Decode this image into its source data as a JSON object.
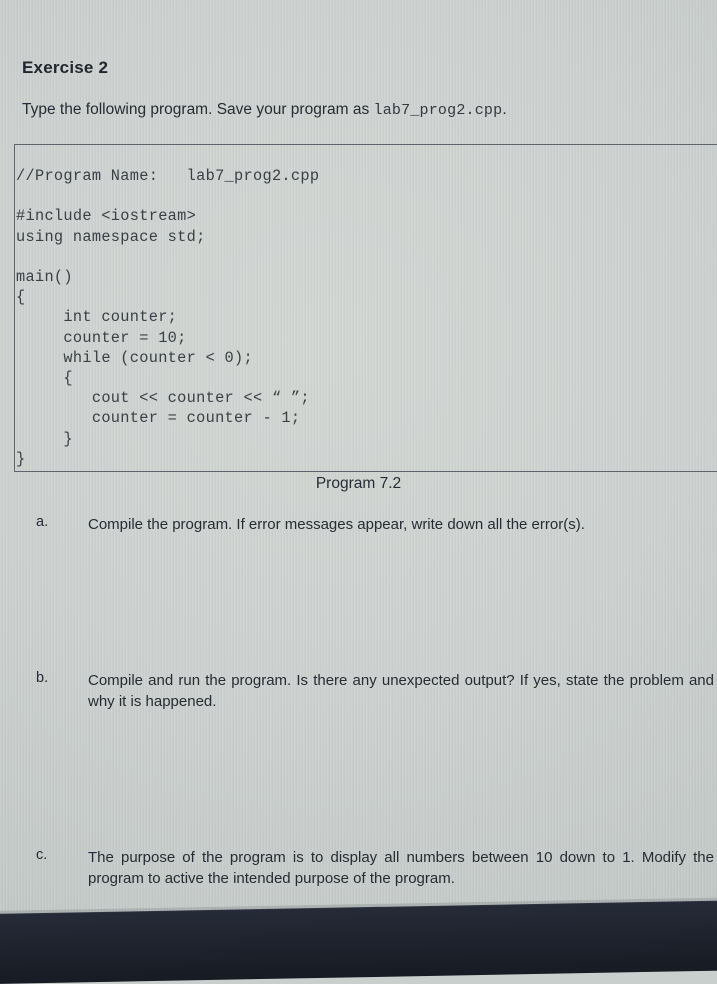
{
  "document": {
    "exercise_title": "Exercise 2",
    "intro": {
      "before_filename": "Type the following program. Save your program as ",
      "filename": "lab7_prog2.cpp",
      "after_filename": "."
    },
    "code_listing": "//Program Name:   lab7_prog2.cpp\n\n#include <iostream>\nusing namespace std;\n\nmain()\n{\n     int counter;\n     counter = 10;\n     while (counter < 0);\n     {\n        cout << counter << “ ”;\n        counter = counter - 1;\n     }\n}",
    "program_caption": "Program 7.2",
    "questions": [
      {
        "letter": "a.",
        "text": "Compile the program. If error messages appear, write down all the error(s)."
      },
      {
        "letter": "b.",
        "text": "Compile and run the program. Is there any unexpected output? If yes, state the problem and why it is happened."
      },
      {
        "letter": "c.",
        "text": "The purpose of the program is to display all numbers between 10 down to 1. Modify the program to active the intended purpose of the program."
      }
    ]
  }
}
